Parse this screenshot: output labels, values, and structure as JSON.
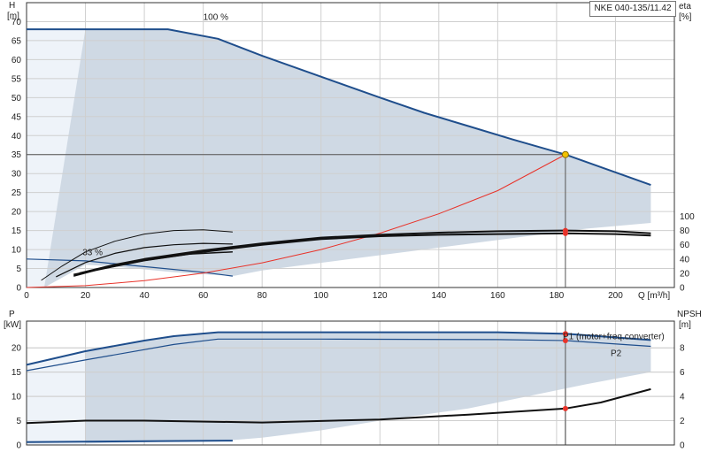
{
  "model_label": "NKE 040-135/11.42",
  "chart_data": [
    {
      "type": "line",
      "panel": "head",
      "xlabel": "Q [m³/h]",
      "xlim": [
        0,
        220
      ],
      "x_ticks": [
        0,
        20,
        40,
        60,
        80,
        100,
        120,
        140,
        160,
        180,
        200
      ],
      "ylabel_left": [
        "H",
        "[m]"
      ],
      "ylim_left": [
        0,
        75
      ],
      "y_ticks_left": [
        0,
        5,
        10,
        15,
        20,
        25,
        30,
        35,
        40,
        45,
        50,
        55,
        60,
        65,
        70
      ],
      "ylabel_right": [
        "eta",
        "[%]"
      ],
      "ylim_right": [
        0,
        400
      ],
      "y_ticks_right": [
        0,
        20,
        40,
        60,
        80,
        100
      ],
      "grid": true,
      "annotations": [
        {
          "text": "100 %",
          "x": 60,
          "y": 70.5
        },
        {
          "text": "33 %",
          "x": 19,
          "y": 8.5
        }
      ],
      "duty_point": {
        "q": 183,
        "h": 35
      },
      "series": [
        {
          "key": "envelope_region",
          "color": "#cfd9e4",
          "values": [
            [
              0,
              68
            ],
            [
              20,
              68
            ],
            [
              48,
              68
            ],
            [
              65,
              65.5
            ],
            [
              80,
              61
            ],
            [
              100,
              55.5
            ],
            [
              120,
              50
            ],
            [
              135,
              46
            ],
            [
              150,
              42.5
            ],
            [
              165,
              39
            ],
            [
              183,
              35
            ],
            [
              212,
              27
            ],
            [
              212,
              17
            ],
            [
              190,
              15.5
            ],
            [
              170,
              13.5
            ],
            [
              150,
              11.5
            ],
            [
              130,
              9.5
            ],
            [
              110,
              7.5
            ],
            [
              90,
              5.5
            ],
            [
              80,
              4.5
            ],
            [
              70,
              3
            ],
            [
              50,
              4
            ],
            [
              30,
              5.5
            ],
            [
              20,
              6
            ],
            [
              6,
              0
            ],
            [
              0,
              0
            ]
          ]
        },
        {
          "key": "low_flow_region",
          "color": "#eef3f9",
          "values": [
            [
              0,
              68
            ],
            [
              20,
              68
            ],
            [
              6,
              0
            ],
            [
              0,
              0
            ]
          ]
        },
        {
          "key": "head_max",
          "color": "#1f4e8c",
          "values": [
            [
              0,
              68
            ],
            [
              20,
              68
            ],
            [
              48,
              68
            ],
            [
              65,
              65.5
            ],
            [
              80,
              61
            ],
            [
              100,
              55.5
            ],
            [
              120,
              50
            ],
            [
              135,
              46
            ],
            [
              150,
              42.5
            ],
            [
              165,
              39
            ],
            [
              183,
              35
            ],
            [
              212,
              27
            ]
          ]
        },
        {
          "key": "head_min",
          "color": "#1f4e8c",
          "values": [
            [
              0,
              7.5
            ],
            [
              20,
              7
            ],
            [
              40,
              5.5
            ],
            [
              60,
              4
            ],
            [
              70,
              3
            ]
          ]
        },
        {
          "key": "system_curve",
          "color": "#e8332a",
          "values": [
            [
              0,
              0
            ],
            [
              20,
              0.5
            ],
            [
              40,
              1.8
            ],
            [
              60,
              3.8
            ],
            [
              80,
              6.5
            ],
            [
              100,
              10
            ],
            [
              120,
              14.3
            ],
            [
              140,
              19.4
            ],
            [
              160,
              25.5
            ],
            [
              183,
              35
            ]
          ]
        },
        {
          "key": "eta_total",
          "color": "#111111",
          "values": [
            [
              18,
              20
            ],
            [
              30,
              32
            ],
            [
              40,
              40
            ],
            [
              60,
              52
            ],
            [
              80,
              62
            ],
            [
              100,
              70
            ],
            [
              120,
              74
            ],
            [
              140,
              77
            ],
            [
              160,
              79
            ],
            [
              183,
              80
            ],
            [
              200,
              79
            ],
            [
              212,
              76
            ]
          ]
        },
        {
          "key": "eta_pump",
          "color": "#111111",
          "values": [
            [
              16,
              18
            ],
            [
              30,
              30
            ],
            [
              40,
              38
            ],
            [
              60,
              50
            ],
            [
              80,
              60
            ],
            [
              100,
              68
            ],
            [
              120,
              72
            ],
            [
              140,
              74
            ],
            [
              160,
              75
            ],
            [
              183,
              76
            ],
            [
              200,
              75
            ],
            [
              212,
              73
            ]
          ]
        },
        {
          "key": "eta_part_1",
          "color": "#111111",
          "values": [
            [
              5,
              10
            ],
            [
              12,
              30
            ],
            [
              20,
              50
            ],
            [
              30,
              65
            ],
            [
              40,
              75
            ],
            [
              50,
              80
            ],
            [
              60,
              81
            ],
            [
              70,
              78
            ]
          ]
        },
        {
          "key": "eta_part_2",
          "color": "#111111",
          "values": [
            [
              10,
              15
            ],
            [
              20,
              35
            ],
            [
              30,
              48
            ],
            [
              40,
              56
            ],
            [
              50,
              60
            ],
            [
              60,
              62
            ],
            [
              70,
              61
            ]
          ]
        },
        {
          "key": "eta_part_3",
          "color": "#111111",
          "values": [
            [
              16,
              16
            ],
            [
              25,
              26
            ],
            [
              40,
              38
            ],
            [
              55,
              47
            ],
            [
              70,
              50
            ]
          ]
        }
      ]
    },
    {
      "type": "line",
      "panel": "power",
      "xlim": [
        0,
        220
      ],
      "ylabel_left": [
        "P",
        "[kW]"
      ],
      "ylim_left": [
        0,
        25.5
      ],
      "y_ticks_left": [
        0,
        5,
        10,
        15,
        20
      ],
      "ylabel_right": [
        "NPSH",
        "[m]"
      ],
      "ylim_right": [
        0,
        10.2
      ],
      "y_ticks_right": [
        0,
        2,
        4,
        6,
        8
      ],
      "grid": true,
      "series": [
        {
          "key": "power_region",
          "color": "#cfd9e4",
          "values": [
            [
              0,
              0
            ],
            [
              20,
              0
            ],
            [
              20,
              19.3
            ],
            [
              40,
              21.5
            ],
            [
              50,
              22.4
            ],
            [
              65,
              23.2
            ],
            [
              100,
              23.2
            ],
            [
              160,
              23.2
            ],
            [
              183,
              22.9
            ],
            [
              212,
              21.6
            ],
            [
              212,
              15
            ],
            [
              190,
              12.5
            ],
            [
              170,
              10
            ],
            [
              150,
              7.5
            ],
            [
              120,
              5
            ],
            [
              100,
              3
            ],
            [
              80,
              1.5
            ],
            [
              70,
              1
            ]
          ]
        },
        {
          "key": "power_low_region",
          "color": "#eef3f9",
          "values": [
            [
              0,
              0
            ],
            [
              20,
              0
            ],
            [
              20,
              19.3
            ],
            [
              0,
              16.5
            ]
          ]
        },
        {
          "name": "P1 (motor+freq.converter)",
          "key": "p1",
          "color": "#1f4e8c",
          "values": [
            [
              0,
              16.5
            ],
            [
              20,
              19.3
            ],
            [
              40,
              21.5
            ],
            [
              50,
              22.4
            ],
            [
              65,
              23.2
            ],
            [
              100,
              23.2
            ],
            [
              160,
              23.2
            ],
            [
              183,
              22.9
            ],
            [
              212,
              21.6
            ]
          ]
        },
        {
          "name": "P2",
          "key": "p2",
          "color": "#1f4e8c",
          "values": [
            [
              0,
              15.3
            ],
            [
              20,
              17.5
            ],
            [
              50,
              20.7
            ],
            [
              65,
              21.8
            ],
            [
              100,
              21.8
            ],
            [
              160,
              21.7
            ],
            [
              183,
              21.5
            ],
            [
              212,
              20.3
            ]
          ]
        },
        {
          "key": "p_min",
          "color": "#1f4e8c",
          "values": [
            [
              0,
              0.6
            ],
            [
              20,
              0.7
            ],
            [
              70,
              0.9
            ]
          ]
        },
        {
          "key": "npsh",
          "color": "#111111",
          "axis": "right",
          "values": [
            [
              0,
              1.8
            ],
            [
              20,
              2
            ],
            [
              40,
              2
            ],
            [
              80,
              1.85
            ],
            [
              120,
              2.1
            ],
            [
              150,
              2.5
            ],
            [
              183,
              3
            ],
            [
              195,
              3.5
            ],
            [
              212,
              4.6
            ]
          ]
        }
      ],
      "markers": [
        {
          "q": 183,
          "value": 22.9,
          "axis": "left"
        },
        {
          "q": 183,
          "value": 21.5,
          "axis": "left"
        },
        {
          "q": 183,
          "value": 3,
          "axis": "right"
        }
      ]
    }
  ]
}
